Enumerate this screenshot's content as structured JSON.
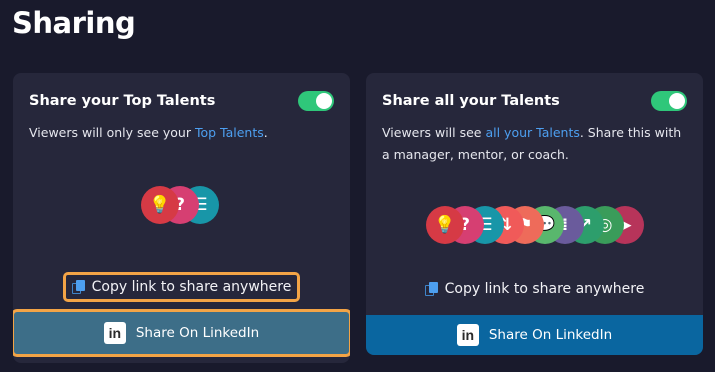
{
  "page": {
    "title": "Sharing"
  },
  "colors": {
    "toggle_on": "#2fc77a",
    "link": "#4d9ff0",
    "highlight": "#f3a446",
    "linkedin": "#0a66a0"
  },
  "cards": [
    {
      "title": "Share your Top Talents",
      "toggle_on": true,
      "desc_prefix": "Viewers will only see your ",
      "desc_link": "Top Talents",
      "desc_suffix": ".",
      "copy_label": "Copy link to share anywhere",
      "linkedin_label": "Share On LinkedIn",
      "icons": [
        {
          "name": "lightbulb-icon",
          "color": "#d63a45",
          "glyph": "💡"
        },
        {
          "name": "question-icon",
          "color": "#d63f72",
          "glyph": "?"
        },
        {
          "name": "list-icon",
          "color": "#1896a8",
          "glyph": "☰"
        }
      ]
    },
    {
      "title": "Share all your Talents",
      "toggle_on": true,
      "desc_prefix": "Viewers will see ",
      "desc_link": "all your Talents",
      "desc_suffix": ". Share this with a manager, mentor, or coach.",
      "copy_label": "Copy link to share anywhere",
      "linkedin_label": "Share On LinkedIn",
      "icons": [
        {
          "name": "lightbulb-icon",
          "color": "#d63a45",
          "glyph": "💡"
        },
        {
          "name": "question-icon",
          "color": "#d63f72",
          "glyph": "?"
        },
        {
          "name": "list-icon",
          "color": "#1896a8",
          "glyph": "☰"
        },
        {
          "name": "arrows-icon",
          "color": "#f05a59",
          "glyph": "⇅"
        },
        {
          "name": "runner-icon",
          "color": "#ee6b5a",
          "glyph": "⚑"
        },
        {
          "name": "chat-icon",
          "color": "#59b76d",
          "glyph": "💬"
        },
        {
          "name": "dots-icon",
          "color": "#6a5b9c",
          "glyph": "⁞"
        },
        {
          "name": "arrow-up-icon",
          "color": "#2d9e6c",
          "glyph": "↗"
        },
        {
          "name": "target-icon",
          "color": "#3a9c5a",
          "glyph": "◎"
        },
        {
          "name": "play-icon",
          "color": "#b7345a",
          "glyph": "▶"
        }
      ]
    }
  ],
  "linkedin_logo_text": "in"
}
